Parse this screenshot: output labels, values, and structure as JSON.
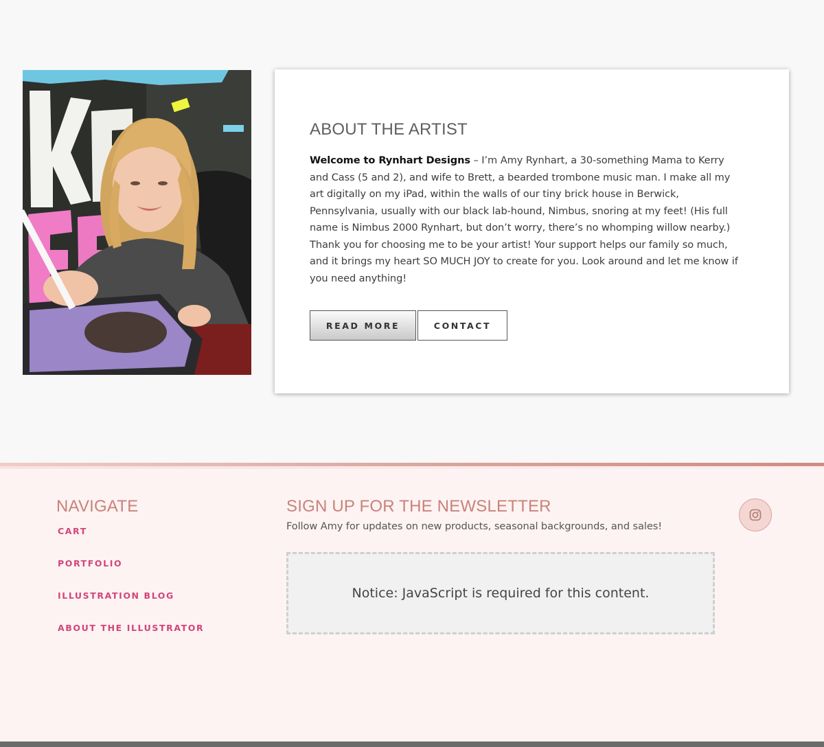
{
  "about": {
    "title": "ABOUT THE ARTIST",
    "intro_bold": "Welcome to Rynhart Designs",
    "intro_rest": " – I’m Amy Rynhart, a 30-something Mama to Kerry and Cass (5 and 2), and wife to Brett, a bearded trombone music man. I make all my art digitally on my iPad, within the walls of our tiny brick house in Berwick, Pennsylvania, usually with our black lab-hound, Nimbus, snoring at my feet! (His full name is Nimbus 2000 Rynhart, but don’t worry, there’s no whomping willow nearby.) Thank you for choosing me to be your artist! Your support helps our family so much, and it brings my heart SO MUCH JOY to create for you. Look around and let me know if you need anything!",
    "read_more_label": "READ MORE",
    "contact_label": "CONTACT",
    "photo_icon": "artist-photo"
  },
  "footer": {
    "navigate_heading": "NAVIGATE",
    "nav_items": [
      {
        "label": "CART"
      },
      {
        "label": "PORTFOLIO"
      },
      {
        "label": "ILLUSTRATION BLOG"
      },
      {
        "label": "ABOUT THE ILLUSTRATOR"
      }
    ],
    "newsletter_heading": "SIGN UP FOR THE NEWSLETTER",
    "newsletter_subtitle": "Follow Amy for updates on new products, seasonal backgrounds, and sales!",
    "notice_text": "Notice: JavaScript is required for this content.",
    "social_icon": "instagram-icon"
  },
  "colors": {
    "footer_heading": "#c8827a",
    "nav_link": "#d1457c",
    "footer_bg": "#fdf3f2",
    "page_bg": "#f8f8f8"
  }
}
